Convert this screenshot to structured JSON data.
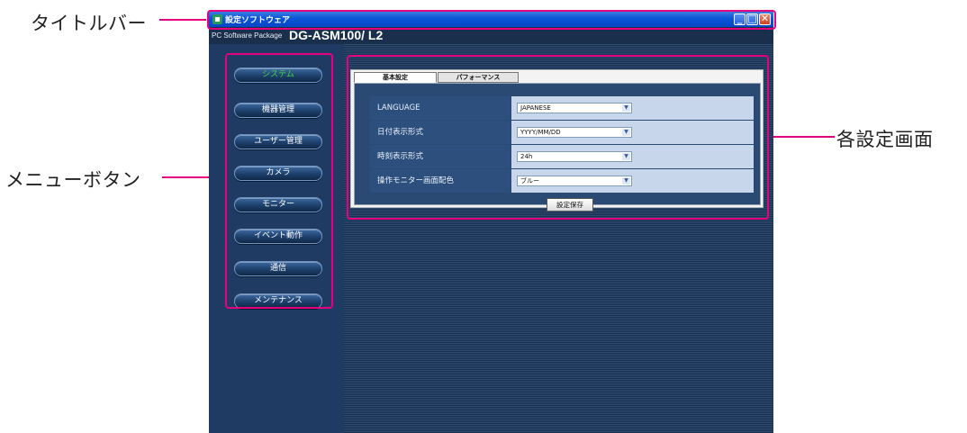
{
  "callouts": {
    "titlebar": "タイトルバー",
    "menu_buttons": "メニューボタン",
    "settings_screen": "各設定画面"
  },
  "window": {
    "title": "設定ソフトウェア",
    "minimize_glyph": "_",
    "maximize_glyph": "□",
    "close_glyph": "✕"
  },
  "product": {
    "package_label": "PC Software Package",
    "model": "DG-ASM100/ L2"
  },
  "menu": {
    "items": [
      {
        "label": "システム",
        "active": true
      },
      {
        "label": "機器管理",
        "active": false
      },
      {
        "label": "ユーザー管理",
        "active": false
      },
      {
        "label": "カメラ",
        "active": false
      },
      {
        "label": "モニター",
        "active": false
      },
      {
        "label": "イベント動作",
        "active": false
      },
      {
        "label": "通信",
        "active": false
      },
      {
        "label": "メンテナンス",
        "active": false
      }
    ]
  },
  "tabs": {
    "basic": "基本設定",
    "performance": "パフォーマンス"
  },
  "settings": {
    "rows": [
      {
        "label": "LANGUAGE",
        "value": "JAPANESE"
      },
      {
        "label": "日付表示形式",
        "value": "YYYY/MM/DD"
      },
      {
        "label": "時刻表示形式",
        "value": "24h"
      },
      {
        "label": "操作モニター画面配色",
        "value": "ブルー"
      }
    ],
    "save_label": "設定保存"
  },
  "colors": {
    "highlight": "#e4007f",
    "active_menu_text": "#3fd93f",
    "titlebar_blue": "#0a55d8"
  }
}
